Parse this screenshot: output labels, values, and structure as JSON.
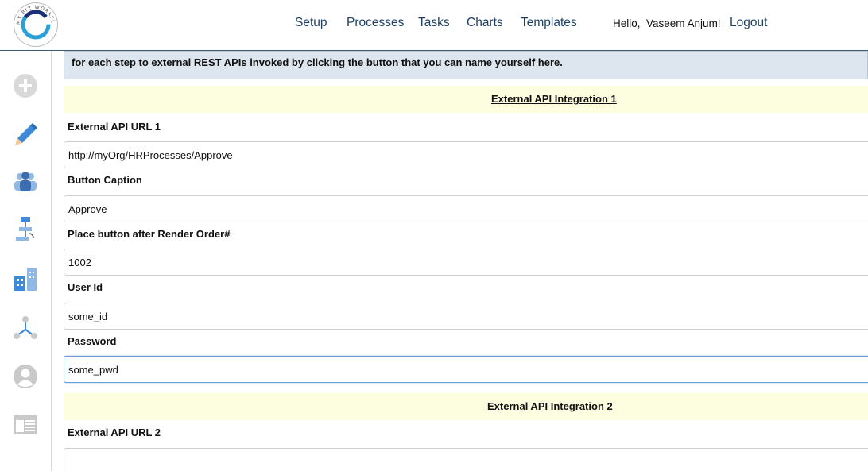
{
  "header": {
    "logo_text": "MY BIZ WORKFLOW",
    "nav": {
      "setup": "Setup",
      "processes": "Processes",
      "tasks": "Tasks",
      "charts": "Charts",
      "templates": "Templates"
    },
    "greeting": "Hello,  Vaseem Anjum!",
    "logout": "Logout"
  },
  "sidebar": {
    "items": [
      "plus-circle-icon",
      "pencil-icon",
      "team-icon",
      "flowchart-icon",
      "buildings-icon",
      "network-icon",
      "user-avatar-icon",
      "layout-icon"
    ]
  },
  "main": {
    "info_text": "for each step to external REST APIs invoked by clicking the button that you can name yourself here.",
    "integration1": {
      "title": "External API Integration 1",
      "url_label": "External API URL 1",
      "url_value": "http://myOrg/HRProcesses/Approve",
      "caption_label": "Button Caption",
      "caption_value": "Approve",
      "order_label": "Place button after Render Order#",
      "order_value": "1002",
      "userid_label": "User Id",
      "userid_value": "some_id",
      "password_label": "Password",
      "password_value": "some_pwd"
    },
    "integration2": {
      "title": "External API Integration 2",
      "url_label": "External API URL 2",
      "url_value": ""
    }
  },
  "colors": {
    "nav_text": "#1e3f66",
    "section_bg": "#fdfde0",
    "info_bg": "#dde6ee"
  }
}
